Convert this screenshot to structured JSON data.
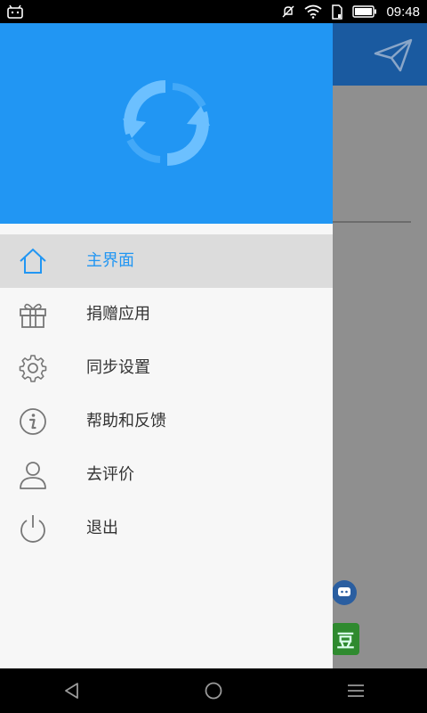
{
  "status_bar": {
    "time": "09:48",
    "icons": [
      "android-icon",
      "mute-icon",
      "wifi-icon",
      "sim-icon",
      "battery-icon"
    ]
  },
  "drawer": {
    "menu": [
      {
        "label": "主界面",
        "icon": "home-icon",
        "active": true
      },
      {
        "label": "捐赠应用",
        "icon": "gift-icon",
        "active": false
      },
      {
        "label": "同步设置",
        "icon": "gear-icon",
        "active": false
      },
      {
        "label": "帮助和反馈",
        "icon": "info-icon",
        "active": false
      },
      {
        "label": "去评价",
        "icon": "user-icon",
        "active": false
      },
      {
        "label": "退出",
        "icon": "power-icon",
        "active": false
      }
    ]
  },
  "background": {
    "green_badge": "豆"
  },
  "colors": {
    "accent": "#2196f3",
    "drawer_bg": "#f7f7f7",
    "active_item_bg": "#dcdcdc",
    "text": "#333333"
  },
  "nav_bar": {
    "buttons": [
      "back-icon",
      "home-circle-icon",
      "menu-icon"
    ]
  }
}
